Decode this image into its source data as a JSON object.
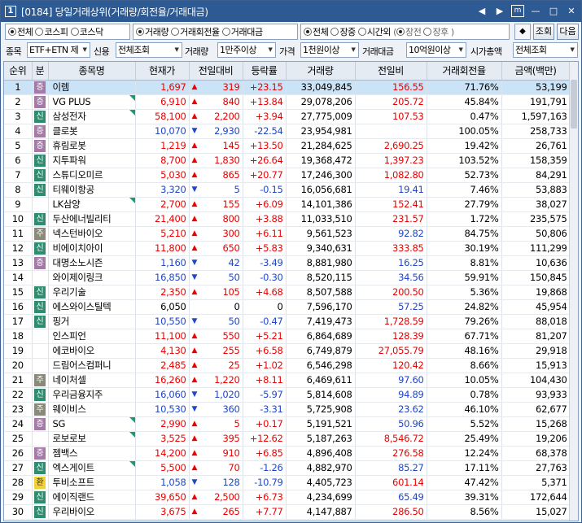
{
  "window": {
    "num": "1",
    "title": "[0184] 당일거래상위(거래량/회전율/거래대금)"
  },
  "titlebar_buttons": [
    "◀",
    "▶",
    "m",
    "—",
    "□",
    "✕"
  ],
  "market": [
    {
      "label": "전체",
      "on": true
    },
    {
      "label": "코스피",
      "on": false
    },
    {
      "label": "코스닥",
      "on": false
    }
  ],
  "sort": [
    {
      "label": "거래량",
      "on": true
    },
    {
      "label": "거래회전율",
      "on": false
    },
    {
      "label": "거래대금",
      "on": false
    }
  ],
  "session": [
    {
      "label": "전체",
      "on": true
    },
    {
      "label": "장중",
      "on": false
    },
    {
      "label": "시간외",
      "on": false
    }
  ],
  "session_sub": {
    "open": "(",
    "close": ")",
    "items": [
      {
        "label": "장전",
        "on": true
      },
      {
        "label": "장후",
        "on": false
      }
    ]
  },
  "buttons": {
    "query": "조회",
    "next": "다음"
  },
  "filters": {
    "item_label": "종목",
    "item_value": "ETF+ETN 제",
    "credit_label": "신용",
    "credit_value": "전체조회",
    "volume_label": "거래량",
    "volume_value": "1만주이상",
    "price_label": "가격",
    "price_value": "1천원이상",
    "amount_label": "거래대금",
    "amount_value": "10억원이상",
    "cap_label": "시가총액",
    "cap_value": "전체조회"
  },
  "columns": [
    "순위",
    "분",
    "종목명",
    "현재가",
    "전일대비",
    "등락률",
    "거래량",
    "전일비",
    "거래회전율",
    "금액(백만)"
  ],
  "rows": [
    {
      "rank": "1",
      "cat": "증",
      "cc": "p",
      "name": "이렘",
      "tri": false,
      "price": "1,697",
      "dir": "up",
      "chg": "319",
      "rate": "+23.15",
      "vol": "33,049,845",
      "prev": "156.55",
      "turn": "71.76%",
      "amt": "53,199"
    },
    {
      "rank": "2",
      "cat": "증",
      "cc": "p",
      "name": "VG PLUS",
      "tri": true,
      "price": "6,910",
      "dir": "up",
      "chg": "840",
      "rate": "+13.84",
      "vol": "29,078,206",
      "prev": "205.72",
      "turn": "45.84%",
      "amt": "191,791"
    },
    {
      "rank": "3",
      "cat": "신",
      "cc": "g",
      "name": "삼성전자",
      "tri": true,
      "price": "58,100",
      "dir": "up",
      "chg": "2,200",
      "rate": "+3.94",
      "vol": "27,775,009",
      "prev": "107.53",
      "turn": "0.47%",
      "amt": "1,597,163"
    },
    {
      "rank": "4",
      "cat": "증",
      "cc": "p",
      "name": "클로봇",
      "tri": false,
      "price": "10,070",
      "dir": "down",
      "chg": "2,930",
      "rate": "-22.54",
      "vol": "23,954,981",
      "prev": "",
      "turn": "100.05%",
      "amt": "258,733"
    },
    {
      "rank": "5",
      "cat": "증",
      "cc": "p",
      "name": "휴림로봇",
      "tri": false,
      "price": "1,219",
      "dir": "up",
      "chg": "145",
      "rate": "+13.50",
      "vol": "21,284,625",
      "prev": "2,690.25",
      "turn": "19.42%",
      "amt": "26,761"
    },
    {
      "rank": "6",
      "cat": "신",
      "cc": "g",
      "name": "지투파워",
      "tri": false,
      "price": "8,700",
      "dir": "up",
      "chg": "1,830",
      "rate": "+26.64",
      "vol": "19,368,472",
      "prev": "1,397.23",
      "turn": "103.52%",
      "amt": "158,359"
    },
    {
      "rank": "7",
      "cat": "신",
      "cc": "g",
      "name": "스튜디오미르",
      "tri": false,
      "price": "5,030",
      "dir": "up",
      "chg": "865",
      "rate": "+20.77",
      "vol": "17,246,300",
      "prev": "1,082.80",
      "turn": "52.73%",
      "amt": "84,291"
    },
    {
      "rank": "8",
      "cat": "신",
      "cc": "g",
      "name": "티웨이항공",
      "tri": false,
      "price": "3,320",
      "dir": "down",
      "chg": "5",
      "rate": "-0.15",
      "vol": "16,056,681",
      "prev": "19.41",
      "turn": "7.46%",
      "amt": "53,883"
    },
    {
      "rank": "9",
      "cat": "",
      "cc": "",
      "name": "LK삼양",
      "tri": true,
      "price": "2,700",
      "dir": "up",
      "chg": "155",
      "rate": "+6.09",
      "vol": "14,101,386",
      "prev": "152.41",
      "turn": "27.79%",
      "amt": "38,027"
    },
    {
      "rank": "10",
      "cat": "신",
      "cc": "g",
      "name": "두산에너빌리티",
      "tri": false,
      "price": "21,400",
      "dir": "up",
      "chg": "800",
      "rate": "+3.88",
      "vol": "11,033,510",
      "prev": "231.57",
      "turn": "1.72%",
      "amt": "235,575"
    },
    {
      "rank": "11",
      "cat": "주",
      "cc": "t",
      "name": "넥스턴바이오",
      "tri": false,
      "price": "5,210",
      "dir": "up",
      "chg": "300",
      "rate": "+6.11",
      "vol": "9,561,523",
      "prev": "92.82",
      "turn": "84.75%",
      "amt": "50,806"
    },
    {
      "rank": "12",
      "cat": "신",
      "cc": "g",
      "name": "비에이치아이",
      "tri": false,
      "price": "11,800",
      "dir": "up",
      "chg": "650",
      "rate": "+5.83",
      "vol": "9,340,631",
      "prev": "333.85",
      "turn": "30.19%",
      "amt": "111,299"
    },
    {
      "rank": "13",
      "cat": "증",
      "cc": "p",
      "name": "대명소노시즌",
      "tri": false,
      "price": "1,160",
      "dir": "down",
      "chg": "42",
      "rate": "-3.49",
      "vol": "8,881,980",
      "prev": "16.25",
      "turn": "8.81%",
      "amt": "10,636"
    },
    {
      "rank": "14",
      "cat": "",
      "cc": "",
      "name": "와이제이링크",
      "tri": false,
      "price": "16,850",
      "dir": "down",
      "chg": "50",
      "rate": "-0.30",
      "vol": "8,520,115",
      "prev": "34.56",
      "turn": "59.91%",
      "amt": "150,845"
    },
    {
      "rank": "15",
      "cat": "신",
      "cc": "g",
      "name": "우리기술",
      "tri": false,
      "price": "2,350",
      "dir": "up",
      "chg": "105",
      "rate": "+4.68",
      "vol": "8,507,588",
      "prev": "200.50",
      "turn": "5.36%",
      "amt": "19,868"
    },
    {
      "rank": "16",
      "cat": "신",
      "cc": "g",
      "name": "에스와이스틸텍",
      "tri": false,
      "price": "6,050",
      "dir": "none",
      "chg": "0",
      "rate": "0",
      "vol": "7,596,170",
      "prev": "57.25",
      "turn": "24.82%",
      "amt": "45,954"
    },
    {
      "rank": "17",
      "cat": "신",
      "cc": "g",
      "name": "핑거",
      "tri": false,
      "price": "10,550",
      "dir": "down",
      "chg": "50",
      "rate": "-0.47",
      "vol": "7,419,473",
      "prev": "1,728.59",
      "turn": "79.26%",
      "amt": "88,018"
    },
    {
      "rank": "18",
      "cat": "",
      "cc": "",
      "name": "인스피언",
      "tri": false,
      "price": "11,100",
      "dir": "up",
      "chg": "550",
      "rate": "+5.21",
      "vol": "6,864,689",
      "prev": "128.39",
      "turn": "67.71%",
      "amt": "81,207"
    },
    {
      "rank": "19",
      "cat": "",
      "cc": "",
      "name": "에코바이오",
      "tri": false,
      "price": "4,130",
      "dir": "up",
      "chg": "255",
      "rate": "+6.58",
      "vol": "6,749,879",
      "prev": "27,055.79",
      "turn": "48.16%",
      "amt": "29,918"
    },
    {
      "rank": "20",
      "cat": "",
      "cc": "",
      "name": "드림어스컴퍼니",
      "tri": false,
      "price": "2,485",
      "dir": "up",
      "chg": "25",
      "rate": "+1.02",
      "vol": "6,546,298",
      "prev": "120.42",
      "turn": "8.66%",
      "amt": "15,913"
    },
    {
      "rank": "21",
      "cat": "주",
      "cc": "t",
      "name": "네이처셀",
      "tri": false,
      "price": "16,260",
      "dir": "up",
      "chg": "1,220",
      "rate": "+8.11",
      "vol": "6,469,611",
      "prev": "97.60",
      "turn": "10.05%",
      "amt": "104,430"
    },
    {
      "rank": "22",
      "cat": "신",
      "cc": "g",
      "name": "우리금융지주",
      "tri": false,
      "price": "16,060",
      "dir": "down",
      "chg": "1,020",
      "rate": "-5.97",
      "vol": "5,814,608",
      "prev": "94.89",
      "turn": "0.78%",
      "amt": "93,933"
    },
    {
      "rank": "23",
      "cat": "주",
      "cc": "t",
      "name": "웨이비스",
      "tri": false,
      "price": "10,530",
      "dir": "down",
      "chg": "360",
      "rate": "-3.31",
      "vol": "5,725,908",
      "prev": "23.62",
      "turn": "46.10%",
      "amt": "62,677"
    },
    {
      "rank": "24",
      "cat": "증",
      "cc": "p",
      "name": "SG",
      "tri": true,
      "price": "2,990",
      "dir": "up",
      "chg": "5",
      "rate": "+0.17",
      "vol": "5,191,521",
      "prev": "50.96",
      "turn": "5.52%",
      "amt": "15,268"
    },
    {
      "rank": "25",
      "cat": "",
      "cc": "",
      "name": "로보로보",
      "tri": true,
      "price": "3,525",
      "dir": "up",
      "chg": "395",
      "rate": "+12.62",
      "vol": "5,187,263",
      "prev": "8,546.72",
      "turn": "25.49%",
      "amt": "19,206"
    },
    {
      "rank": "26",
      "cat": "증",
      "cc": "p",
      "name": "젬백스",
      "tri": false,
      "price": "14,200",
      "dir": "up",
      "chg": "910",
      "rate": "+6.85",
      "vol": "4,896,408",
      "prev": "276.58",
      "turn": "12.24%",
      "amt": "68,378"
    },
    {
      "rank": "27",
      "cat": "신",
      "cc": "g",
      "name": "엑스게이트",
      "tri": true,
      "price": "5,500",
      "dir": "up",
      "chg": "70",
      "rate": "-1.26",
      "vol": "4,882,970",
      "prev": "85.27",
      "turn": "17.11%",
      "amt": "27,763"
    },
    {
      "rank": "28",
      "cat": "환",
      "cc": "y",
      "name": "투비소프트",
      "tri": false,
      "price": "1,058",
      "dir": "down",
      "chg": "128",
      "rate": "-10.79",
      "vol": "4,405,723",
      "prev": "601.14",
      "turn": "47.42%",
      "amt": "5,371"
    },
    {
      "rank": "29",
      "cat": "신",
      "cc": "g",
      "name": "에이직랜드",
      "tri": false,
      "price": "39,650",
      "dir": "up",
      "chg": "2,500",
      "rate": "+6.73",
      "vol": "4,234,699",
      "prev": "65.49",
      "turn": "39.31%",
      "amt": "172,644"
    },
    {
      "rank": "30",
      "cat": "신",
      "cc": "g",
      "name": "우리바이오",
      "tri": false,
      "price": "3,675",
      "dir": "up",
      "chg": "265",
      "rate": "+7.77",
      "vol": "4,147,887",
      "prev": "286.50",
      "turn": "8.56%",
      "amt": "15,027"
    }
  ],
  "colors": {
    "up": "#e00000",
    "down": "#1f47c9",
    "title_bg": "#2d5a93",
    "selected_row": "#cbe3f7"
  }
}
